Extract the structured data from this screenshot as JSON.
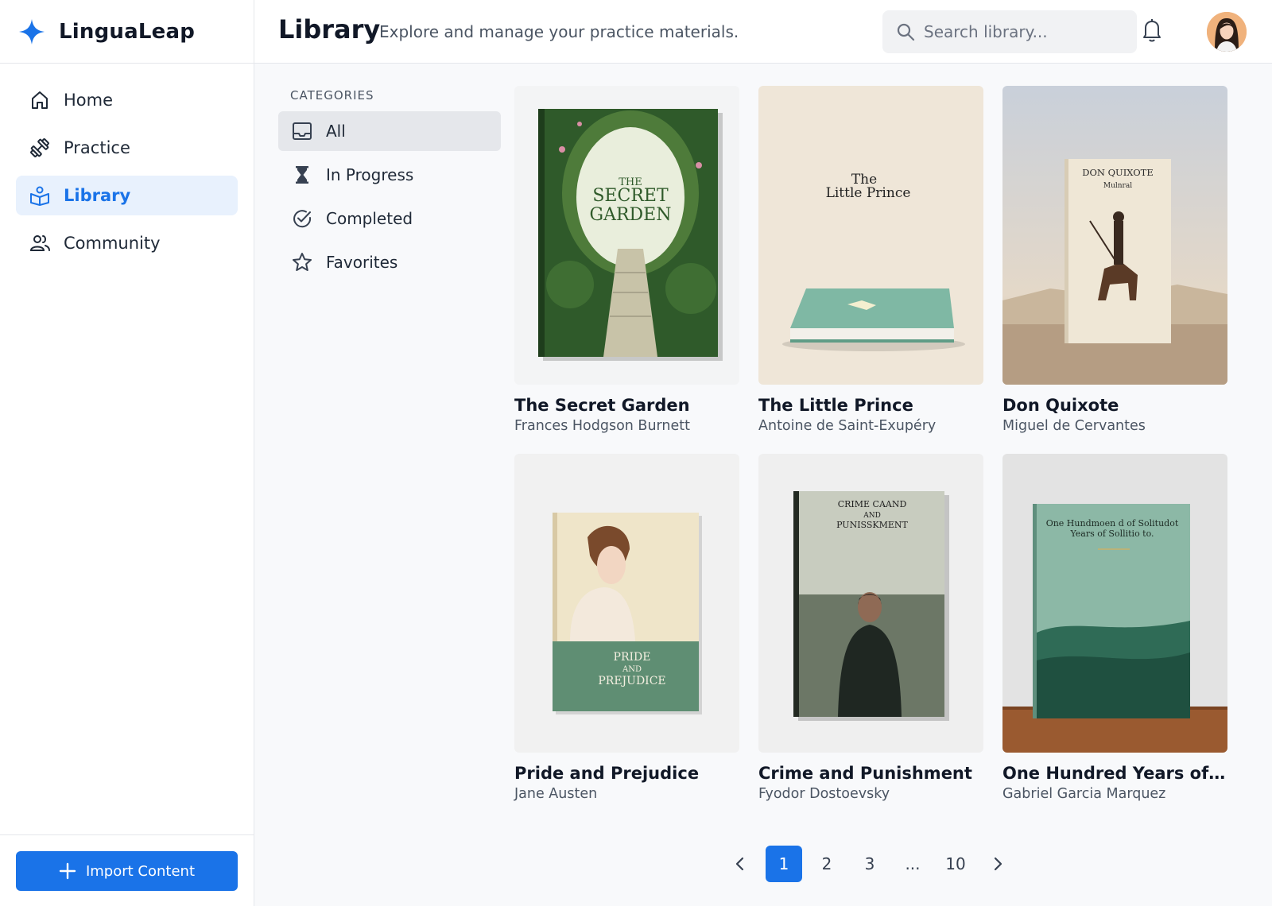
{
  "app": {
    "name": "LinguaLeap"
  },
  "sidebar": {
    "items": [
      {
        "label": "Home",
        "icon": "home-icon"
      },
      {
        "label": "Practice",
        "icon": "dumbbell-icon"
      },
      {
        "label": "Library",
        "icon": "book-reader-icon",
        "active": true
      },
      {
        "label": "Community",
        "icon": "users-icon"
      }
    ],
    "import_label": "Import Content"
  },
  "header": {
    "title": "Library",
    "subtitle": "Explore and manage your practice materials.",
    "search_placeholder": "Search library..."
  },
  "categories": {
    "heading": "CATEGORIES",
    "items": [
      {
        "label": "All",
        "icon": "inbox-icon",
        "active": true
      },
      {
        "label": "In Progress",
        "icon": "hourglass-icon"
      },
      {
        "label": "Completed",
        "icon": "check-circle-icon"
      },
      {
        "label": "Favorites",
        "icon": "star-icon"
      }
    ]
  },
  "books": [
    {
      "title": "The Secret Garden",
      "author": "Frances Hodgson Burnett",
      "cover_lines": [
        "THE",
        "SECRET",
        "GARDEN"
      ]
    },
    {
      "title": "The Little Prince",
      "author": "Antoine de Saint-Exupéry",
      "cover_lines": [
        "The",
        "Little Prince"
      ]
    },
    {
      "title": "Don Quixote",
      "author": "Miguel de Cervantes",
      "cover_lines": [
        "DON QUIXOTE",
        "Mulnral"
      ]
    },
    {
      "title": "Pride and Prejudice",
      "author": "Jane Austen",
      "cover_lines": [
        "PRIDE",
        "AND",
        "PREJUDICE"
      ]
    },
    {
      "title": "Crime and Punishment",
      "author": "Fyodor Dostoevsky",
      "cover_lines": [
        "CRIME CAAND",
        "AND",
        "PUNISSKMENT"
      ]
    },
    {
      "title": "One Hundred Years of Solit...",
      "author": "Gabriel Garcia Marquez",
      "cover_lines": [
        "One Hundmoen d of Solitudot",
        "Years of Sollitio to."
      ]
    }
  ],
  "pagination": {
    "pages": [
      "1",
      "2",
      "3",
      "...",
      "10"
    ],
    "current": "1"
  },
  "colors": {
    "accent": "#1a73e8",
    "active_nav_bg": "#e8f1fd"
  }
}
